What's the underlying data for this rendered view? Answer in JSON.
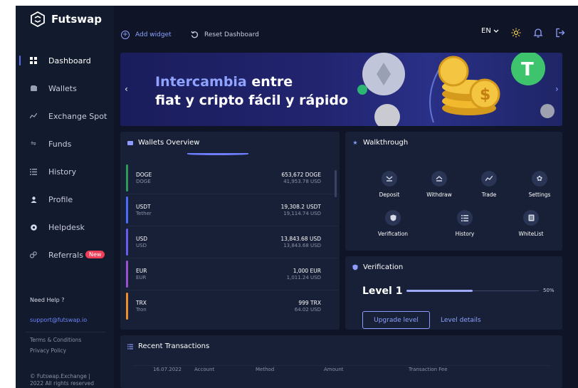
{
  "brand": {
    "name": "Futswap"
  },
  "sidebar": {
    "items": [
      {
        "label": "Dashboard",
        "icon": "grid-icon"
      },
      {
        "label": "Wallets",
        "icon": "wallet-icon"
      },
      {
        "label": "Exchange Spot",
        "icon": "chart-icon"
      },
      {
        "label": "Funds",
        "icon": "transfer-icon"
      },
      {
        "label": "History",
        "icon": "list-icon"
      },
      {
        "label": "Profile",
        "icon": "user-icon"
      },
      {
        "label": "Helpdesk",
        "icon": "help-icon"
      },
      {
        "label": "Referrals",
        "icon": "referral-icon",
        "badge": "New"
      }
    ],
    "active_index": 0,
    "help_title": "Need Help ?",
    "help_email": "support@futswap.io",
    "terms": "Terms & Conditions",
    "privacy": "Privacy Policy",
    "copyright_line1": "© Futswap.Exchange |",
    "copyright_line2": "2022 All rights reserved"
  },
  "topbar": {
    "add_widget": "Add widget",
    "reset_dashboard": "Reset Dashboard",
    "language": "EN"
  },
  "banner": {
    "highlight": "Intercambia",
    "title_rest": " entre",
    "title_line2": "fiat y cripto fácil y rápido",
    "prev_arrow": "‹",
    "next_arrow": "›"
  },
  "wallets": {
    "title": "Wallets Overview",
    "rows": [
      {
        "symbol": "DOGE",
        "name": "DOGE",
        "amount": "653,672 DOGE",
        "usd": "41,953.78 USD",
        "color": "#2e9a57"
      },
      {
        "symbol": "USDT",
        "name": "Tether",
        "amount": "19,308.2 USDT",
        "usd": "19,114.74 USD",
        "color": "#4a6cf7"
      },
      {
        "symbol": "USD",
        "name": "USD",
        "amount": "13,843.68 USD",
        "usd": "13,843.68 USD",
        "color": "#6a5cf0"
      },
      {
        "symbol": "EUR",
        "name": "EUR",
        "amount": "1,000 EUR",
        "usd": "1,011.24 USD",
        "color": "#9b4fd0"
      },
      {
        "symbol": "TRX",
        "name": "Tron",
        "amount": "999 TRX",
        "usd": "64.02 USD",
        "color": "#f08c2b"
      }
    ]
  },
  "walkthrough": {
    "title": "Walkthrough",
    "items": [
      {
        "label": "Deposit",
        "icon": "chevron-down-icon"
      },
      {
        "label": "Withdraw",
        "icon": "chevron-up-icon"
      },
      {
        "label": "Trade",
        "icon": "trend-icon"
      },
      {
        "label": "Settings",
        "icon": "gear-icon"
      },
      {
        "label": "Verification",
        "icon": "shield-icon"
      },
      {
        "label": "History",
        "icon": "list-icon"
      },
      {
        "label": "WhiteList",
        "icon": "document-icon"
      }
    ]
  },
  "verification": {
    "title": "Verification",
    "level": "Level 1",
    "progress": 0.5,
    "progress_label": "50%",
    "upgrade_label": "Upgrade level",
    "details_label": "Level details"
  },
  "transactions": {
    "title": "Recent Transactions",
    "columns": [
      "16.07.2022",
      "Account",
      "Method",
      "Amount",
      "Transaction Fee"
    ]
  },
  "colors": {
    "accent": "#8ea0ff",
    "background": "#0f1526",
    "card": "#172036",
    "badge": "#ef3e58"
  }
}
